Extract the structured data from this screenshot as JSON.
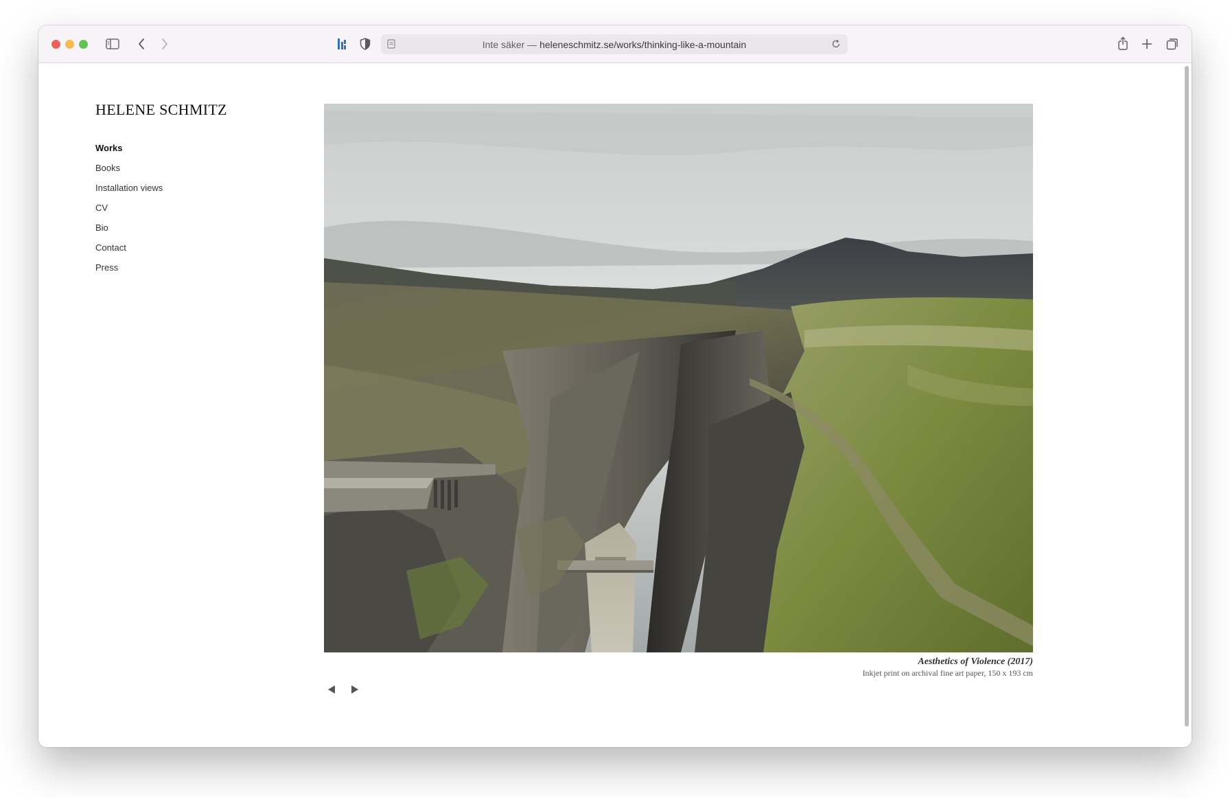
{
  "browser": {
    "url_prefix": "Inte säker — ",
    "url": "heleneschmitz.se/works/thinking-like-a-mountain",
    "icons": {
      "sidebar": "sidebar-icon",
      "back": "chevron-left-icon",
      "forward": "chevron-right-icon",
      "extension": "extension-icon",
      "privacy": "shield-icon",
      "page": "page-icon",
      "reload": "reload-icon",
      "share": "share-icon",
      "new_tab": "plus-icon",
      "tabs": "tabs-overview-icon"
    },
    "colors": {
      "close": "#ee5f57",
      "minimize": "#f5bd4f",
      "zoom": "#5fc454"
    }
  },
  "site": {
    "title": "HELENE SCHMITZ",
    "nav": [
      {
        "label": "Works",
        "active": true
      },
      {
        "label": "Books",
        "active": false
      },
      {
        "label": "Installation views",
        "active": false
      },
      {
        "label": "CV",
        "active": false
      },
      {
        "label": "Bio",
        "active": false
      },
      {
        "label": "Contact",
        "active": false
      },
      {
        "label": "Press",
        "active": false
      }
    ]
  },
  "artwork": {
    "caption_title": "Aesthetics of Violence (2017)",
    "caption_desc": "Inkjet print on archival fine art paper, 150 x 193 cm"
  },
  "gallery_nav": {
    "prev_icon": "triangle-left-icon",
    "next_icon": "triangle-right-icon"
  }
}
